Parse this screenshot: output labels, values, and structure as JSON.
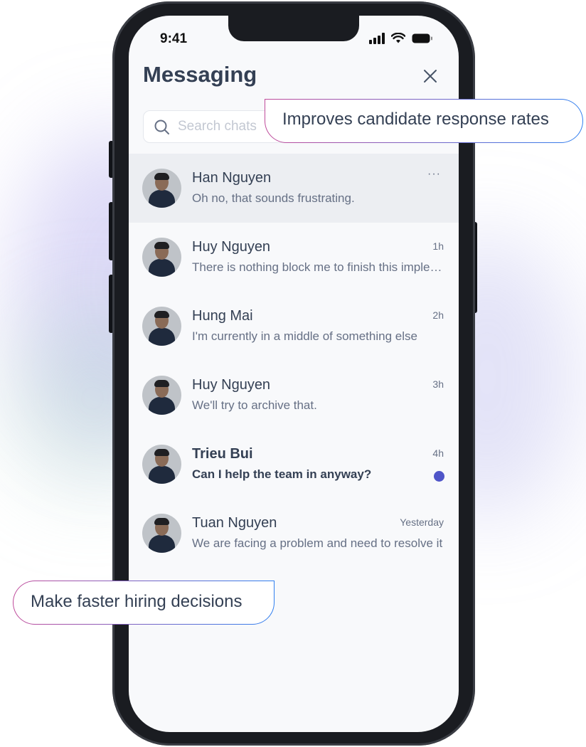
{
  "status_bar": {
    "time": "9:41"
  },
  "header": {
    "title": "Messaging"
  },
  "search": {
    "placeholder": "Search chats"
  },
  "callouts": {
    "top": "Improves candidate response rates",
    "bottom": "Make faster hiring decisions"
  },
  "chats": [
    {
      "name": "Han Nguyen",
      "preview": "Oh no, that sounds frustrating.",
      "time": "",
      "more": "···",
      "active": true,
      "unread": false
    },
    {
      "name": "Huy Nguyen",
      "preview": "There is nothing block me to finish this implementation",
      "time": "1h",
      "unread": false
    },
    {
      "name": "Hung Mai",
      "preview": "I'm currently in a middle of something else",
      "time": "2h",
      "unread": false
    },
    {
      "name": "Huy Nguyen",
      "preview": "We'll try to archive that.",
      "time": "3h",
      "unread": false
    },
    {
      "name": "Trieu Bui",
      "preview": "Can I help the team in anyway?",
      "time": "4h",
      "unread": true
    },
    {
      "name": "Tuan Nguyen",
      "preview": "We are facing a problem and need to resolve it",
      "time": "Yesterday",
      "unread": false
    }
  ],
  "colors": {
    "accent": "#4f55c8",
    "text": "#344054",
    "muted": "#667085"
  }
}
